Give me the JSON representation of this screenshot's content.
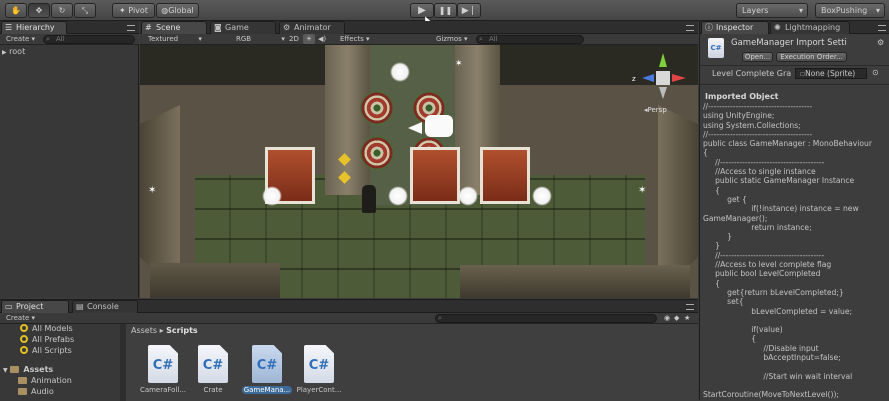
{
  "toolbar": {
    "pivot": "Pivot",
    "global": "Global",
    "layers": "Layers",
    "layout": "BoxPushing"
  },
  "hierarchy": {
    "tab": "Hierarchy",
    "create": "Create",
    "search_placeholder": "All",
    "root": "root"
  },
  "scene": {
    "tabs": [
      "Scene",
      "Game",
      "Animator"
    ],
    "shading": "Textured",
    "color_mode": "RGB",
    "mode_2d": "2D",
    "effects": "Effects",
    "gizmos": "Gizmos",
    "search_placeholder": "All",
    "persp": "Persp"
  },
  "inspector": {
    "tabs": [
      "Inspector",
      "Lightmapping"
    ],
    "title": "GameManager Import Setti",
    "open": "Open...",
    "exec_order": "Execution Order...",
    "field_label": "Level Complete Gra",
    "field_value": "None (Sprite)",
    "imported_object": "Imported Object",
    "code": "//--------------------------------------\nusing UnityEngine;\nusing System.Collections;\n//--------------------------------------\npublic class GameManager : MonoBehaviour\n{\n     //--------------------------------------\n     //Access to single instance\n     public static GameManager Instance\n     {\n          get {\n                    if(!instance) instance = new\nGameManager();\n                    return instance;\n          }\n     }\n     //--------------------------------------\n     //Access to level complete flag\n     public bool LevelCompleted\n     {\n          get{return bLevelCompleted;}\n          set{\n                    bLevelCompleted = value;\n\n                    if(value)\n                    {\n                         //Disable input\n                         bAcceptInput=false;\n\n                         //Start win wait interval\n\nStartCoroutine(MoveToNextLevel());"
  },
  "project": {
    "tabs": [
      "Project",
      "Console"
    ],
    "create": "Create",
    "favorites": [
      "All Models",
      "All Prefabs",
      "All Scripts"
    ],
    "assets_label": "Assets",
    "folders": [
      "Animation",
      "Audio"
    ],
    "breadcrumb_root": "Assets",
    "breadcrumb_sep": "▸",
    "breadcrumb_current": "Scripts",
    "files": [
      {
        "name": "CameraFoll...",
        "icon": "C#"
      },
      {
        "name": "Crate",
        "icon": "C#"
      },
      {
        "name": "GameMana...",
        "icon": "C#"
      },
      {
        "name": "PlayerCont...",
        "icon": "C#"
      }
    ]
  },
  "colors": {
    "accent": "#3d6b99",
    "selected_file": "#3d6b99"
  }
}
